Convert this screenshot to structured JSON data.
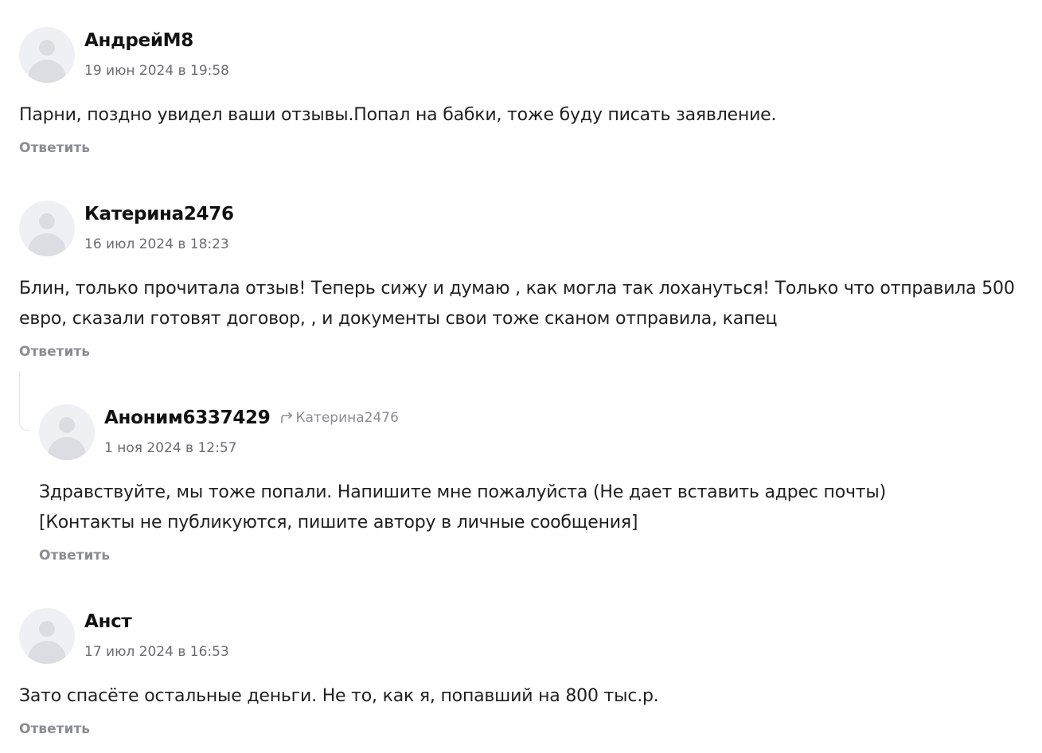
{
  "comments": [
    {
      "author": "АндрейМ8",
      "date": "19 июн 2024 в 19:58",
      "text": "Парни, поздно увидел ваши отзывы.Попал на бабки, тоже буду писать заявление.",
      "reply_label": "Ответить"
    },
    {
      "author": "Катерина2476",
      "date": "16 июл 2024 в 18:23",
      "text": "Блин, только прочитала отзыв! Теперь сижу и думаю , как могла так лохануться! Только что отправила 500 евро, сказали готовят договор, , и документы свои тоже сканом отправила, капец",
      "reply_label": "Ответить",
      "replies": [
        {
          "author": "Аноним6337429",
          "reply_to": "Катерина2476",
          "date": "1 ноя 2024 в 12:57",
          "text_line1": "Здравствуйте, мы тоже попали. Напишите мне пожалуйста (Не дает вставить адрес почты)",
          "text_line2": "[Контакты не публикуются, пишите автору в личные сообщения]",
          "reply_label": "Ответить"
        }
      ]
    },
    {
      "author": "Анст",
      "date": "17 июл 2024 в 16:53",
      "text": "Зато спасёте остальные деньги. Не то, как я, попавший на 800 тыс.р.",
      "reply_label": "Ответить"
    }
  ],
  "colors": {
    "author": "#111111",
    "meta": "#8b8d94",
    "date": "#6a6c73",
    "avatar_bg": "#eff0f4",
    "avatar_fg": "#dcdde3"
  },
  "icons": {
    "avatar": "user-placeholder-icon",
    "reply_to": "reply-arrow-icon"
  }
}
